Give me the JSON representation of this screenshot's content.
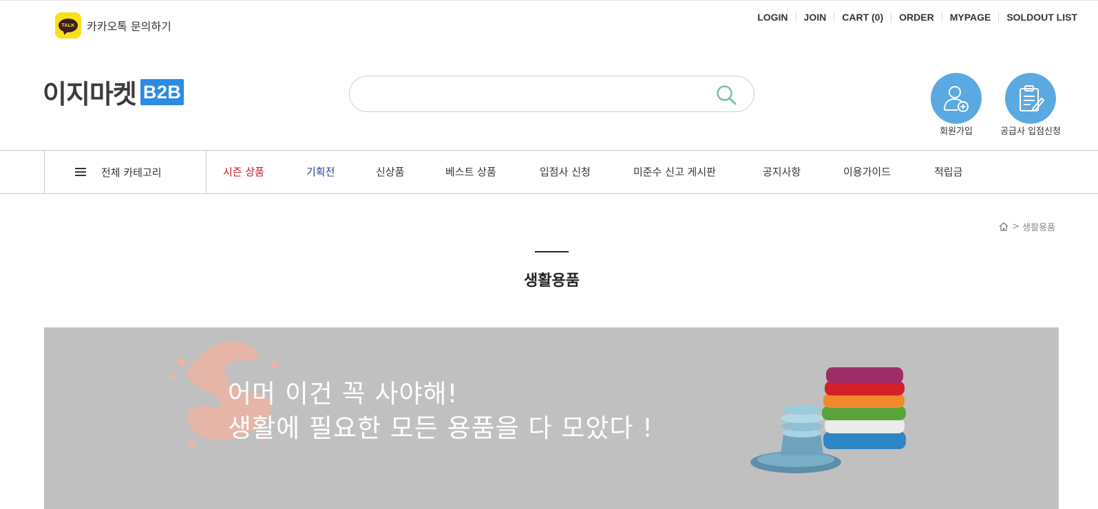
{
  "kakao": {
    "label": "카카오톡 문의하기",
    "badge": "TALK"
  },
  "toplinks": [
    "LOGIN",
    "JOIN",
    "CART (0)",
    "ORDER",
    "MYPAGE",
    "SOLDOUT LIST"
  ],
  "logo": {
    "text": "이지마켓",
    "badge": "B2B"
  },
  "search": {
    "placeholder": ""
  },
  "quick": {
    "join_label": "회원가입",
    "supplier_label": "공급사 입점신청"
  },
  "nav": {
    "all_label": "전체 카테고리",
    "items": [
      "시즌 상품",
      "기획전",
      "신상품",
      "베스트 상품",
      "입점사 신청",
      "미준수 신고 게시판",
      "공지사항",
      "이용가이드",
      "적립금"
    ]
  },
  "breadcrumb": {
    "separator": ">",
    "current": "생활용품"
  },
  "page": {
    "title": "생활용품"
  },
  "banner": {
    "line1": "어머 이건 꼭 사야해!",
    "line2": "생활에 필요한 모든 용품을 다 모았다 !",
    "background": "#c0c0c0"
  },
  "colors": {
    "accent_blue": "#5ba9e1",
    "season_red": "#c8191e",
    "special_blue": "#2a3f9a",
    "kakao_yellow": "#f7e11a",
    "b2b_blue": "#2c8ce2"
  }
}
